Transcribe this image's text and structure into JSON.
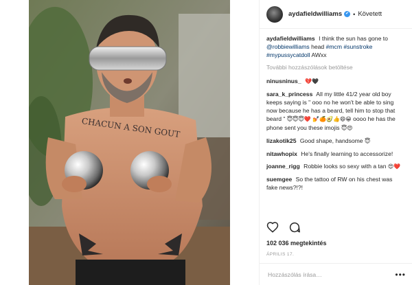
{
  "header": {
    "username": "aydafieldwilliams",
    "verified_mark": "✔",
    "separator": "•",
    "follow_state": "Követett"
  },
  "caption": {
    "username": "aydafieldwilliams",
    "text_1": "I think the sun has gone to",
    "mention": "@robbiewilliams",
    "text_2": "head",
    "hashtag_1": "#mcm",
    "hashtag_2": "#sunstroke",
    "hashtag_3": "#mypussycatdoll",
    "text_3": "AWxx"
  },
  "load_more": "További hozzászólások betöltése",
  "comments": [
    {
      "username": "ninusninus_",
      "text": "",
      "emoji": "💔🖤"
    },
    {
      "username": "sara_k_princess",
      "text": "All my little 41/2 year old boy keeps saying is \" ooo no he won't be able to sing now because he has a beard, tell him to stop that beard \"",
      "emoji": "😇😇😇❤️",
      "emoji_2": "💅🍊🥑👍😄😀",
      "text_2": "oooo he has the phone sent you these imojis",
      "emoji_3": "😇😍"
    },
    {
      "username": "lizakotik25",
      "text": "Good shape, handsome",
      "emoji": "😇"
    },
    {
      "username": "nitawhopix",
      "text": "He's finally learning to accessorize!",
      "emoji": ""
    },
    {
      "username": "joanne_rigg",
      "text": "Robbie looks so sexy with a tan",
      "emoji": "😍❤️"
    },
    {
      "username": "suemgee",
      "text": "So the tattoo of RW on his chest was fake news?!?!",
      "emoji": ""
    }
  ],
  "likes": "102 036 megtekintés",
  "date": "ÁPRILIS 17.",
  "add_comment": {
    "placeholder": "Hozzászólás írása…",
    "more": "•••"
  },
  "photo": {
    "tattoo_text": "CHACUN A SON GOUT"
  },
  "icons": [
    "heart-icon",
    "comment-icon",
    "verified-icon",
    "more-icon"
  ],
  "colors": {
    "link": "#003569",
    "verified": "#3897f0",
    "muted": "#999999",
    "text": "#262626"
  }
}
